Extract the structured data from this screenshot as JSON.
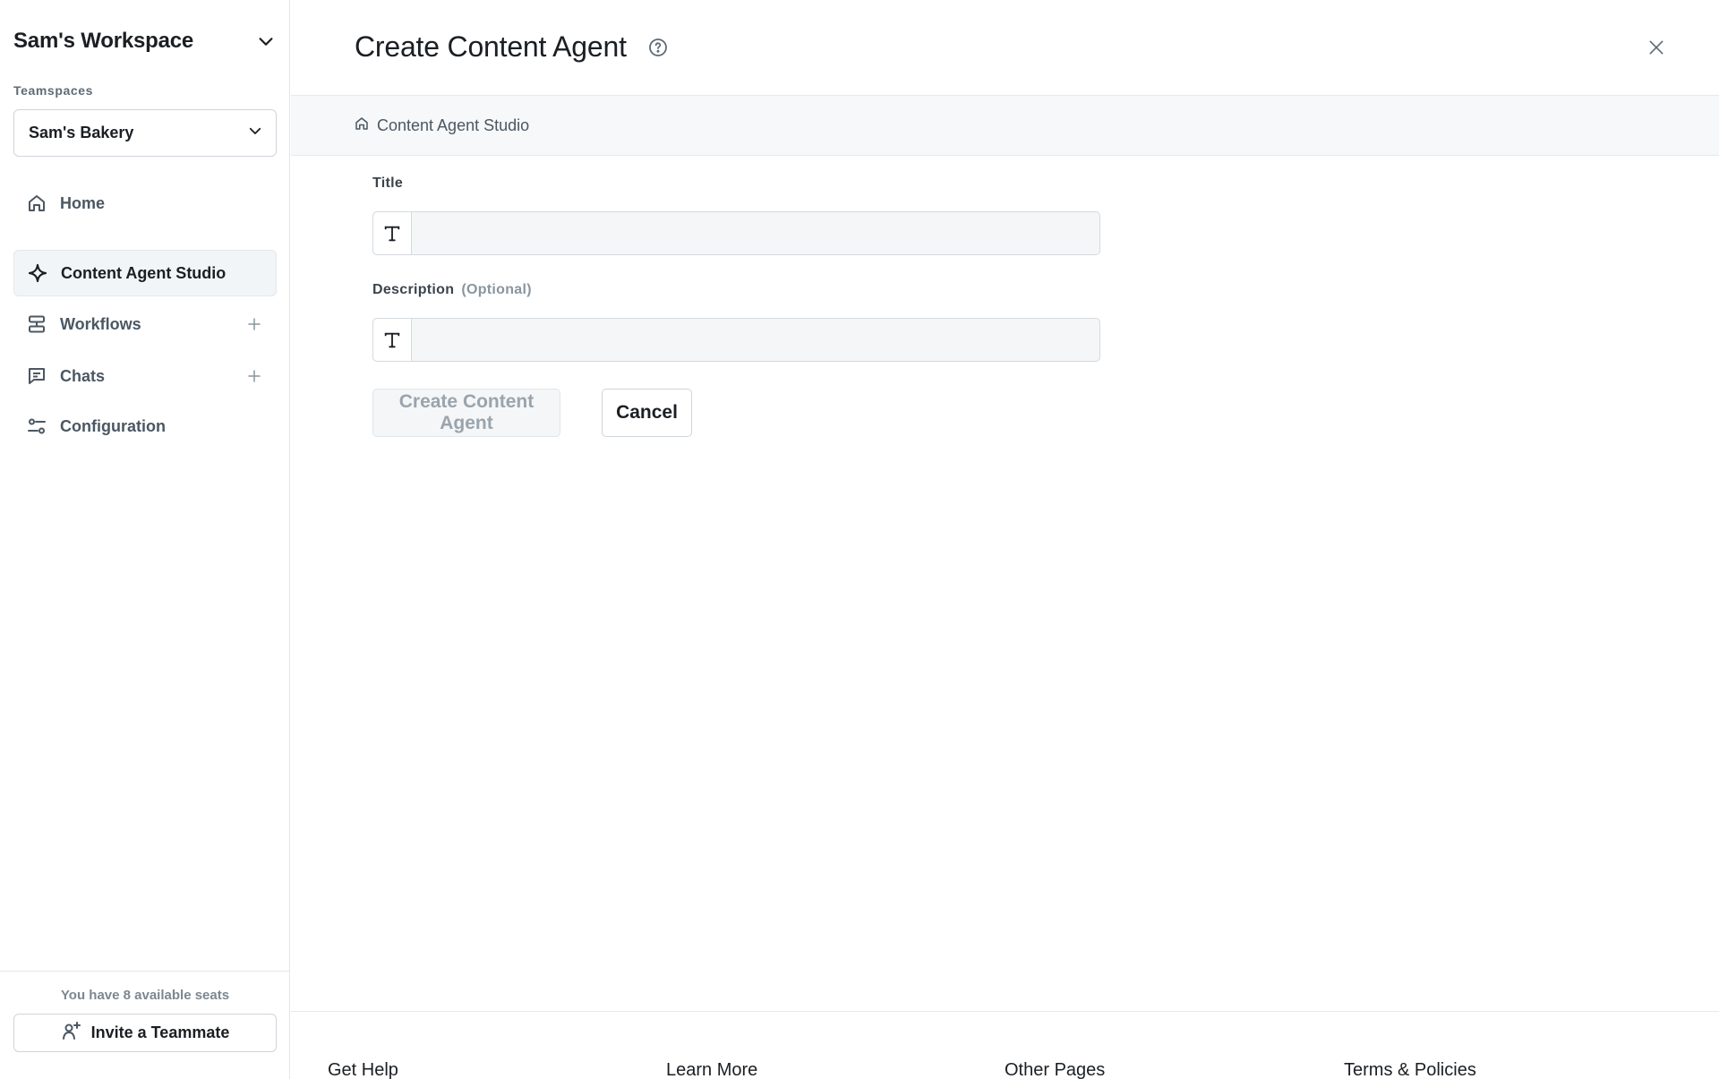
{
  "sidebar": {
    "workspace_title": "Sam's Workspace",
    "teamspaces_label": "Teamspaces",
    "teamspace_selected": "Sam's Bakery",
    "nav": [
      {
        "label": "Home",
        "icon": "home-icon"
      },
      {
        "label": "Content Agent Studio",
        "icon": "sparkle-icon",
        "active": true
      },
      {
        "label": "Workflows",
        "icon": "workflow-icon"
      },
      {
        "label": "Chats",
        "icon": "chat-icon"
      },
      {
        "label": "Configuration",
        "icon": "sliders-icon"
      }
    ],
    "seats_text": "You have 8 available seats",
    "invite_label": "Invite a Teammate"
  },
  "header": {
    "title": "Create Content Agent"
  },
  "breadcrumb": {
    "label": "Content Agent Studio"
  },
  "form": {
    "title_label": "Title",
    "title_value": "",
    "description_label": "Description",
    "description_optional": "(Optional)",
    "description_value": "",
    "create_label": "Create Content Agent",
    "cancel_label": "Cancel"
  },
  "footer": {
    "columns": [
      "Get Help",
      "Learn More",
      "Other Pages",
      "Terms & Policies"
    ]
  },
  "colors": {
    "text_primary": "#1b1f23",
    "text_muted": "#4b5763",
    "border": "#d4dadf",
    "active_bg": "#f2f5f7",
    "disabled_text": "#9aa4ad"
  }
}
